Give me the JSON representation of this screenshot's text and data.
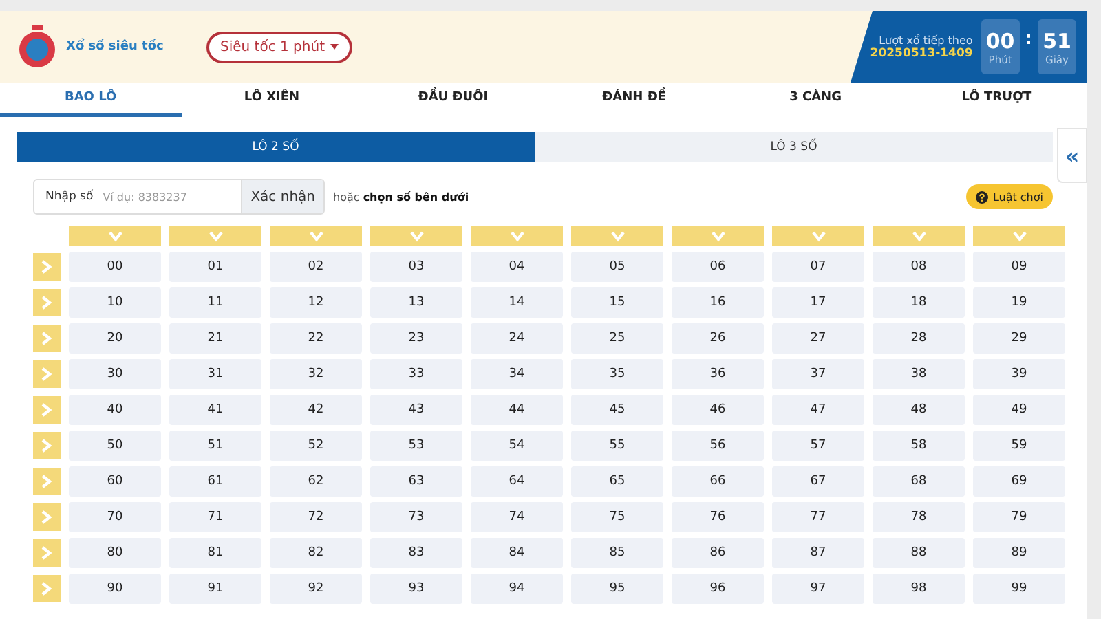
{
  "header": {
    "logo_text": "Xổ số siêu tốc",
    "mode_dropdown": "Siêu tốc 1 phút",
    "countdown": {
      "label": "Lượt xổ tiếp theo",
      "draw_id": "20250513-1409",
      "minutes": "00",
      "minutes_unit": "Phút",
      "separator": ":",
      "seconds": "51",
      "seconds_unit": "Giây"
    }
  },
  "tabs": [
    {
      "label": "BAO LÔ",
      "selected": true
    },
    {
      "label": "LÔ XIÊN",
      "selected": false
    },
    {
      "label": "ĐẦU ĐUÔI",
      "selected": false
    },
    {
      "label": "ĐÁNH ĐỀ",
      "selected": false
    },
    {
      "label": "3 CÀNG",
      "selected": false
    },
    {
      "label": "LÔ TRƯỢT",
      "selected": false
    }
  ],
  "subtabs": [
    {
      "label": "LÔ 2 SỐ",
      "selected": true
    },
    {
      "label": "LÔ 3 SỐ",
      "selected": false
    }
  ],
  "collapse_button": "«",
  "number_input": {
    "label": "Nhập số",
    "placeholder": "Ví dụ: 8383237",
    "button": "Xác nhận"
  },
  "hint": "hoặc **chọn số bên dưới**",
  "rules_button": "Luật chơi",
  "grid": [
    [
      "00",
      "01",
      "02",
      "03",
      "04",
      "05",
      "06",
      "07",
      "08",
      "09"
    ],
    [
      "10",
      "11",
      "12",
      "13",
      "14",
      "15",
      "16",
      "17",
      "18",
      "19"
    ],
    [
      "20",
      "21",
      "22",
      "23",
      "24",
      "25",
      "26",
      "27",
      "28",
      "29"
    ],
    [
      "30",
      "31",
      "32",
      "33",
      "34",
      "35",
      "36",
      "37",
      "38",
      "39"
    ],
    [
      "40",
      "41",
      "42",
      "43",
      "44",
      "45",
      "46",
      "47",
      "48",
      "49"
    ],
    [
      "50",
      "51",
      "52",
      "53",
      "54",
      "55",
      "56",
      "57",
      "58",
      "59"
    ],
    [
      "60",
      "61",
      "62",
      "63",
      "64",
      "65",
      "66",
      "67",
      "68",
      "69"
    ],
    [
      "70",
      "71",
      "72",
      "73",
      "74",
      "75",
      "76",
      "77",
      "78",
      "79"
    ],
    [
      "80",
      "81",
      "82",
      "83",
      "84",
      "85",
      "86",
      "87",
      "88",
      "89"
    ],
    [
      "90",
      "91",
      "92",
      "93",
      "94",
      "95",
      "96",
      "97",
      "98",
      "99"
    ]
  ]
}
